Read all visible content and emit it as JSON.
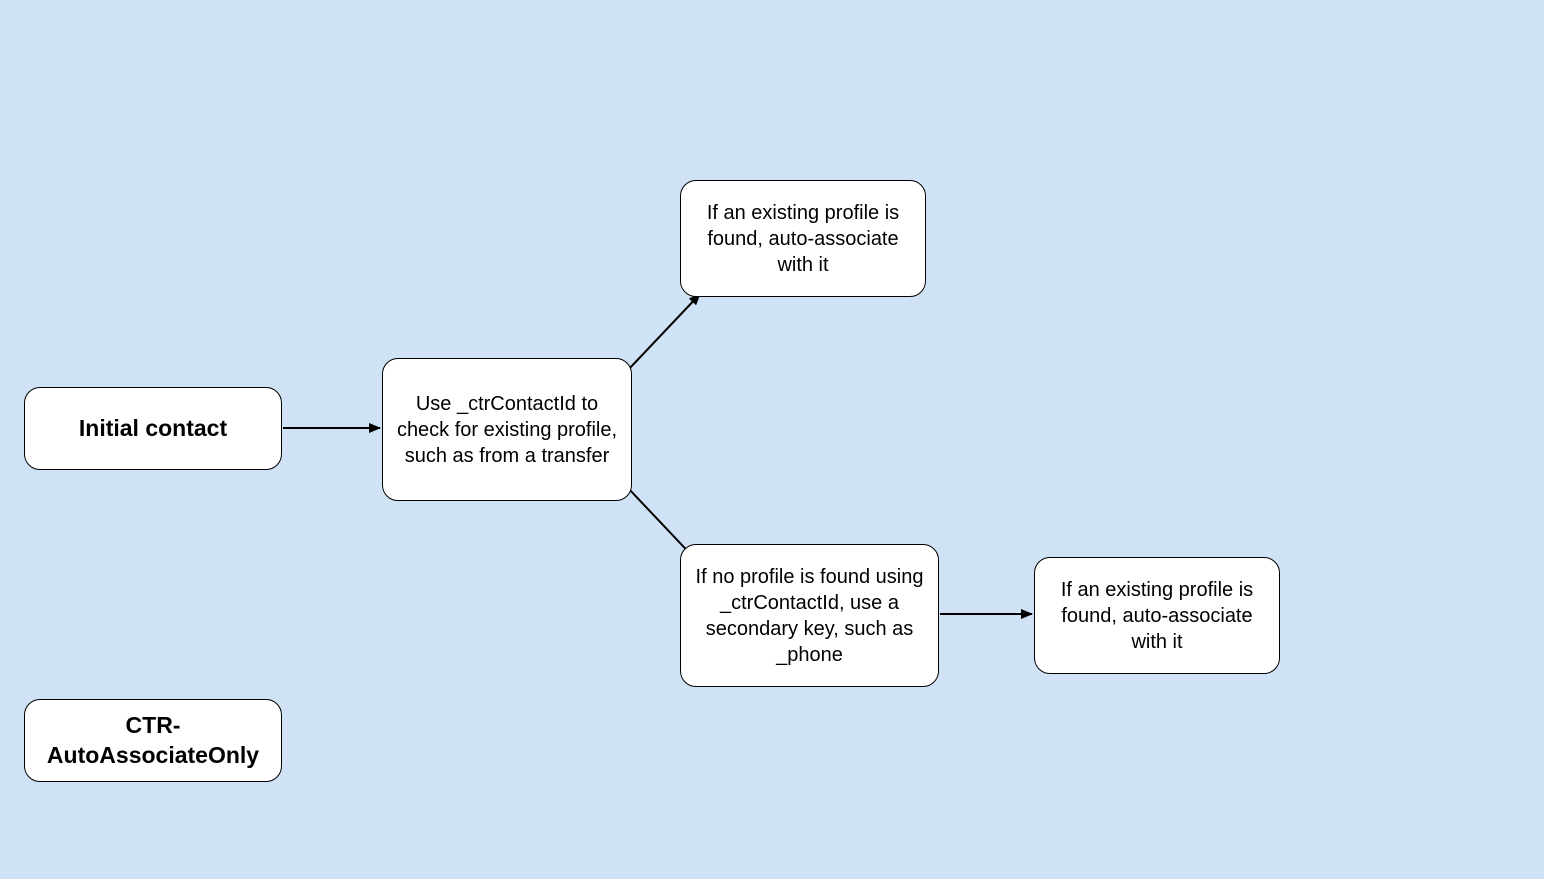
{
  "nodes": {
    "initial_contact": "Initial contact",
    "label_box": "CTR-AutoAssociateOnly",
    "check_profile": "Use _ctrContactId to check for existing profile, such as from a transfer",
    "found_top": "If an existing profile is found, auto-associate with it",
    "not_found": "If no profile is found using _ctrContactId, use a secondary key, such as _phone",
    "found_right": "If an existing profile is found, auto-associate with it"
  }
}
